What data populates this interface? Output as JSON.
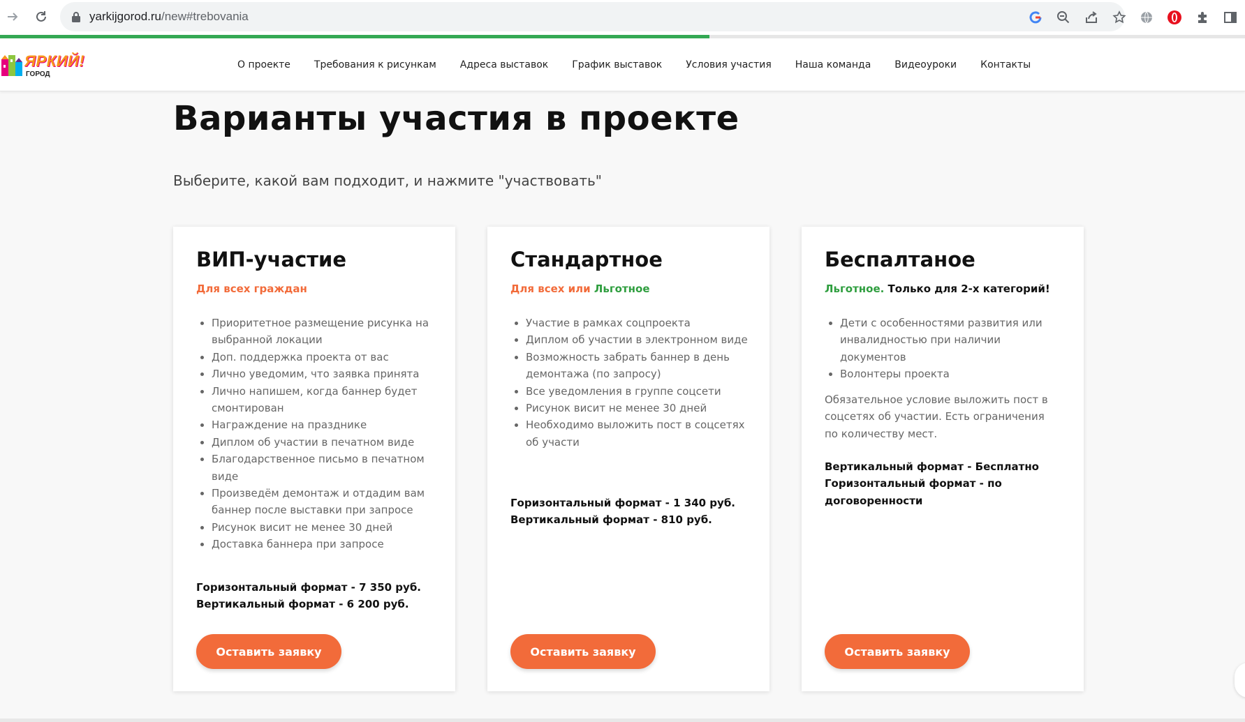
{
  "browser": {
    "url_host": "yarkijgorod.ru",
    "url_path": "/new#trebovania",
    "page_load_progress": 0.57
  },
  "site": {
    "logo_text": "ЯРКИЙ!",
    "logo_sub": "ГОРОД",
    "nav": [
      "О проекте",
      "Требования к рисункам",
      "Адреса выставок",
      "График выставок",
      "Условия участия",
      "Наша команда",
      "Видеоуроки",
      "Контакты"
    ]
  },
  "main": {
    "title": "Варианты участия в проекте",
    "subtitle": "Выберите, какой вам подходит, и нажмите \"участвовать\""
  },
  "cards": [
    {
      "title": "ВИП-участие",
      "tag_parts": [
        {
          "text": "Для всех граждан",
          "color": "orange"
        }
      ],
      "items": [
        "Приоритетное размещение рисунка на выбранной локации",
        "Доп. поддержка проекта от вас",
        "Лично уведомим, что заявка принята",
        "Лично напишем, когда баннер будет смонтирован",
        "Награждение на празднике",
        "Диплом об участии в печатном виде",
        "Благодарственное письмо в печатном виде",
        "Произведём демонтаж и отдадим вам баннер после выставки при запросе",
        "Рисунок висит не менее 30 дней",
        "Доставка баннера при запросе"
      ],
      "note": "",
      "prices": [
        "Горизонтальный формат - 7 350 руб.",
        "Вертикальный формат - 6 200 руб."
      ],
      "button": "Оставить заявку"
    },
    {
      "title": "Стандартное",
      "tag_parts": [
        {
          "text": "Для всех или ",
          "color": "orange"
        },
        {
          "text": "Льготное",
          "color": "green"
        }
      ],
      "items": [
        "Участие в рамках соцпроекта",
        "Диплом об участии в электронном виде",
        "Возможность забрать баннер в день демонтажа (по запросу)",
        "Все уведомления в группе соцсети",
        "Рисунок висит не менее 30 дней",
        "Необходимо выложить пост в соцсетях об участи"
      ],
      "note": "",
      "prices": [
        "Горизонтальный формат - 1 340 руб.",
        "Вертикальный формат - 810 руб."
      ],
      "button": "Оставить заявку"
    },
    {
      "title": "Беспалтаное",
      "tag_parts": [
        {
          "text": "Льготное. ",
          "color": "green"
        },
        {
          "text": "Только для 2-х категорий!",
          "color": "black"
        }
      ],
      "items": [
        "Дети с особенностями развития или инвалидностью при наличии документов",
        "Волонтеры проекта"
      ],
      "note": "Обязательное условие выложить пост в соцсетях об участии. Есть ограничения по количеству мест.",
      "prices": [
        "Вертикальный формат - Бесплатно",
        "Горизонтальный формат - по договоренности"
      ],
      "button": "Оставить заявку"
    }
  ],
  "colors": {
    "accent_orange": "#f26b3a",
    "accent_green": "#2f9e3f",
    "progress_green": "#34a853"
  }
}
